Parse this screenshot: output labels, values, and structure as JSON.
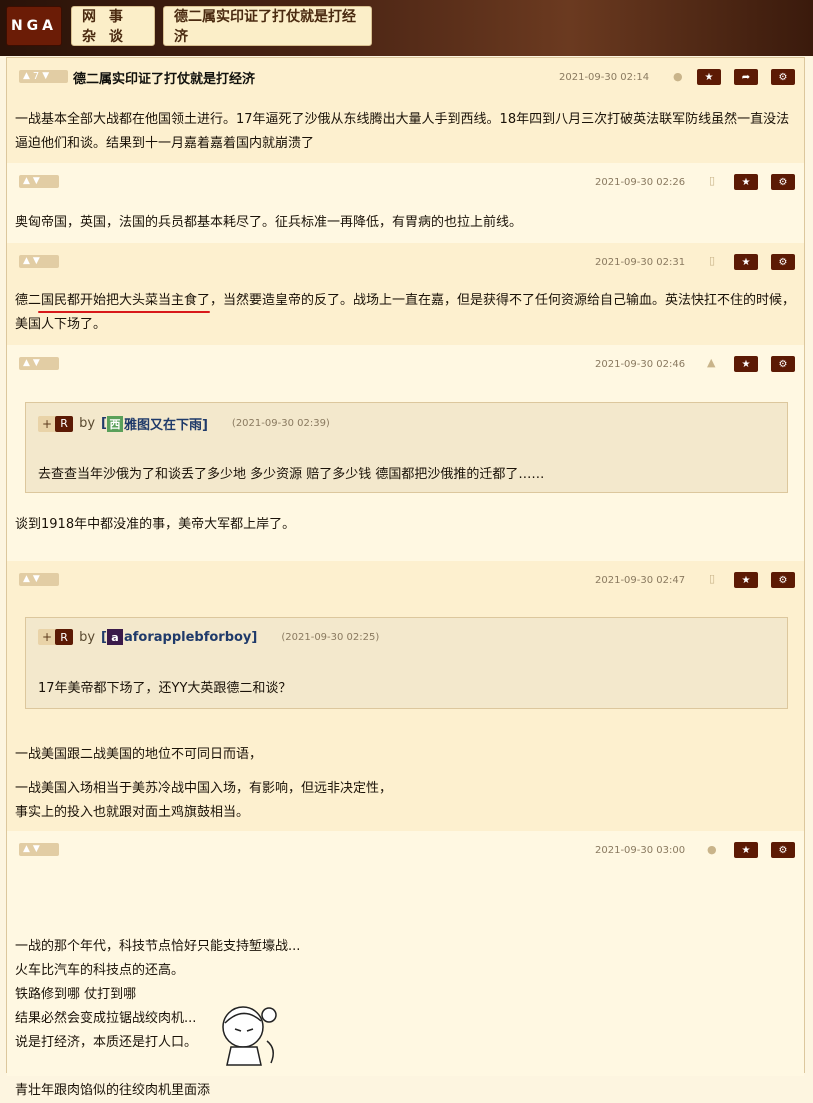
{
  "nav": {
    "logo": "NGA",
    "crumbs": [
      "网 事 杂 谈",
      "德二属实印证了打仗就是打经济"
    ]
  },
  "posts": [
    {
      "likes": "7",
      "title": "德二属实印证了打仗就是打经济",
      "date": "2021-09-30 02:14",
      "device": "apple-icon",
      "lines": [
        "一战基本全部大战都在他国领土进行。17年逼死了沙俄从东线腾出大量人手到西线。18年四到八月三次打破英法联军防线虽然一直没法",
        "逼迫他们和谈。结果到十一月嘉着嘉着国内就崩溃了"
      ]
    },
    {
      "date": "2021-09-30 02:26",
      "device": "phone-icon",
      "lines": [
        "奥匈帝国，英国，法国的兵员都基本耗尽了。征兵标准一再降低，有胃病的也拉上前线。"
      ]
    },
    {
      "date": "2021-09-30 02:31",
      "device": "phone-icon",
      "lines": [
        "德二国民都开始把大头菜当主食了，当然要造皇帝的反了。战场上一直在嘉，但是获得不了任何资源给自己输血。英法快扛不住的时候，",
        "美国人下场了。"
      ]
    },
    {
      "date": "2021-09-30 02:46",
      "device": "android-icon",
      "quote": {
        "avatar": "西",
        "user": "雅图又在下雨]",
        "date": "(2021-09-30 02:39)",
        "text": "去查查当年沙俄为了和谈丢了多少地 多少资源 赔了多少钱 德国都把沙俄推的迁都了……"
      },
      "lines": [
        "谈到1918年中都没准的事，美帝大军都上岸了。"
      ]
    },
    {
      "date": "2021-09-30 02:47",
      "device": "phone-icon",
      "quote": {
        "avatar": "a",
        "user": "aforapplebforboy]",
        "date": "(2021-09-30 02:25)",
        "text": "17年美帝都下场了，还YY大英跟德二和谈？"
      },
      "lines": [
        "一战美国跟二战美国的地位不可同日而语，",
        "一战美国入场相当于美苏冷战中国入场，有影响，但远非决定性，",
        "事实上的投入也就跟对面土鸡旗鼓相当。"
      ]
    },
    {
      "date": "2021-09-30 03:00",
      "device": "apple-icon",
      "lines": [
        "一战的那个年代，科技节点恰好只能支持堑壕战...",
        "火车比汽车的科技点的还高。",
        "铁路修到哪 仗打到哪",
        "结果必然会变成拉锯战绞肉机...",
        "说是打经济，本质还是打人口。",
        "",
        "青壮年跟肉馅似的往绞肉机里面添"
      ]
    }
  ],
  "common": {
    "by": "by",
    "plus": "+",
    "r": "R",
    "bracket_open": "["
  },
  "colors": {
    "accent": "#5c1a04",
    "bg_even": "#fdf0cf",
    "bg_odd": "#fff8e2",
    "username": "#1f3a6a",
    "underline": "#d8191a"
  }
}
